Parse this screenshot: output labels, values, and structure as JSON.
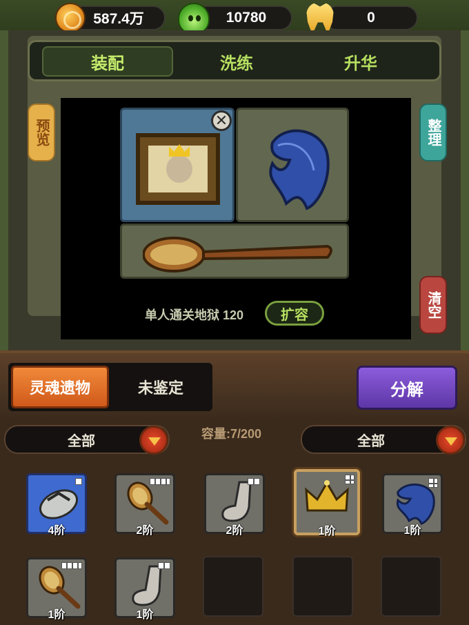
{
  "resources": {
    "coins": "587.4万",
    "souls": "10780",
    "teeth": "0"
  },
  "tabs": [
    {
      "label": "装配",
      "active": true
    },
    {
      "label": "洗练",
      "active": false
    },
    {
      "label": "升华",
      "active": false
    }
  ],
  "side_buttons": {
    "preview": "预览",
    "sort": "整理",
    "clear": "清空"
  },
  "board": {
    "close_glyph": "✕",
    "requirement": "单人通关地狱 120",
    "expand_label": "扩容",
    "slots": [
      {
        "icon": "king-portrait-icon"
      },
      {
        "icon": "blue-feather-icon"
      },
      {
        "icon": "bath-brush-icon"
      }
    ]
  },
  "filters": {
    "soul_relic": "灵魂遗物",
    "unidentified": "未鉴定",
    "decompose": "分解"
  },
  "dropdowns": {
    "left": "全部",
    "right": "全部"
  },
  "capacity": "容量:7/200",
  "colors": {
    "tab_text": "#b6e060",
    "soul_button": "#e06e26",
    "decompose_button": "#7a4cc8",
    "blue_rarity": "#3f6bd0",
    "gray_rarity": "#707068"
  },
  "inventory": [
    {
      "icon": "flip-flop-icon",
      "tier": "4阶",
      "rarity": "blue",
      "mark": "1"
    },
    {
      "icon": "bath-brush-icon",
      "tier": "2阶",
      "rarity": "gray",
      "mark": "4"
    },
    {
      "icon": "sock-icon",
      "tier": "2阶",
      "rarity": "gray",
      "mark": "2"
    },
    {
      "icon": "crown-icon",
      "tier": "1阶",
      "rarity": "gray",
      "mark": "sq",
      "equipped": true
    },
    {
      "icon": "blue-feather-icon",
      "tier": "1阶",
      "rarity": "gray",
      "mark": "sq"
    },
    {
      "icon": "bath-brush-icon",
      "tier": "1阶",
      "rarity": "gray",
      "mark": "4"
    },
    {
      "icon": "sock-icon",
      "tier": "1阶",
      "rarity": "gray",
      "mark": "2"
    }
  ]
}
